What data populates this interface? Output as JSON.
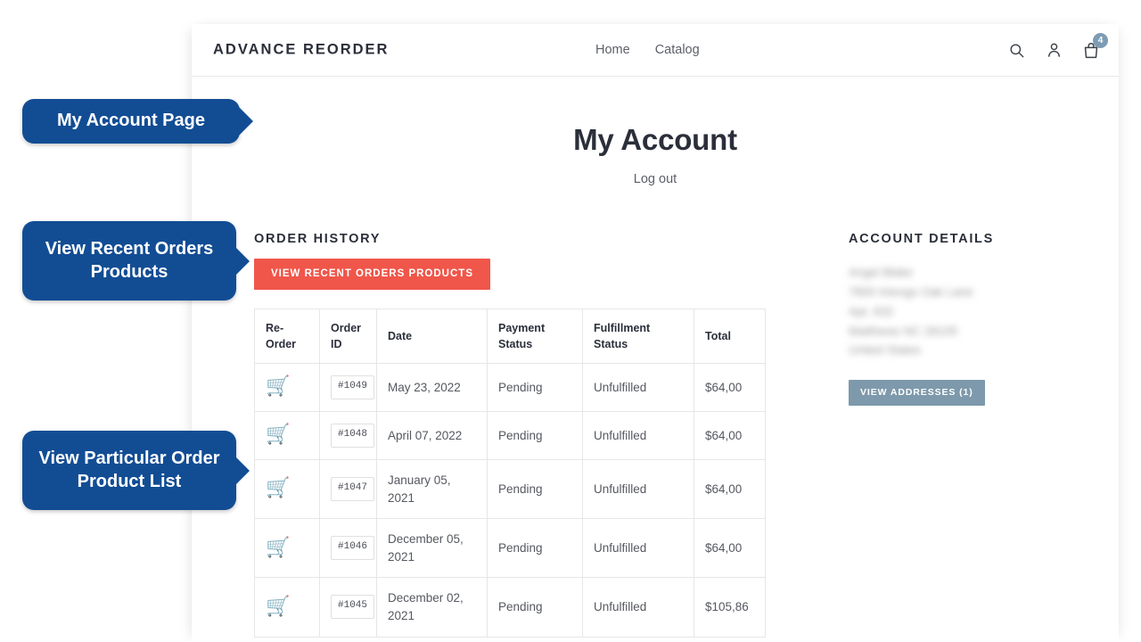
{
  "header": {
    "brand": "ADVANCE REORDER",
    "nav": [
      {
        "label": "Home"
      },
      {
        "label": "Catalog"
      }
    ],
    "icons": {
      "search": "search-icon",
      "account": "user-icon",
      "cart": "shopping-bag-icon"
    },
    "cart_count": "4"
  },
  "account": {
    "title": "My Account",
    "logout_label": "Log out"
  },
  "order_history": {
    "heading": "ORDER HISTORY",
    "recent_button_label": "VIEW RECENT ORDERS PRODUCTS",
    "columns": [
      "Re-Order",
      "Order ID",
      "Date",
      "Payment Status",
      "Fulfillment Status",
      "Total"
    ],
    "reorder_icon": "🛒",
    "rows": [
      {
        "order_id": "#1049",
        "date": "May 23, 2022",
        "payment_status": "Pending",
        "fulfillment_status": "Unfulfilled",
        "total": "$64,00"
      },
      {
        "order_id": "#1048",
        "date": "April 07, 2022",
        "payment_status": "Pending",
        "fulfillment_status": "Unfulfilled",
        "total": "$64,00"
      },
      {
        "order_id": "#1047",
        "date": "January 05, 2021",
        "payment_status": "Pending",
        "fulfillment_status": "Unfulfilled",
        "total": "$64,00"
      },
      {
        "order_id": "#1046",
        "date": "December 05, 2021",
        "payment_status": "Pending",
        "fulfillment_status": "Unfulfilled",
        "total": "$64,00"
      },
      {
        "order_id": "#1045",
        "date": "December 02, 2021",
        "payment_status": "Pending",
        "fulfillment_status": "Unfulfilled",
        "total": "$105,86"
      }
    ]
  },
  "account_details": {
    "heading": "ACCOUNT DETAILS",
    "address_lines": [
      "Angel Blake",
      "7800 Inlongs Oak Lane",
      "Apt. 632",
      "Matthews NC 28105",
      "United States"
    ],
    "addresses_button_label": "VIEW ADDRESSES (1)"
  },
  "callouts": [
    {
      "text": "My Account Page"
    },
    {
      "text": "View Recent Orders Products"
    },
    {
      "text": "View Particular Order Product List"
    }
  ],
  "colors": {
    "callout_blue": "#124d94",
    "recent_button_red": "#f0564a",
    "addresses_button_slate": "#7d99ab",
    "cart_badge": "#7d9cb3",
    "heading_text": "#2b2f3a"
  }
}
